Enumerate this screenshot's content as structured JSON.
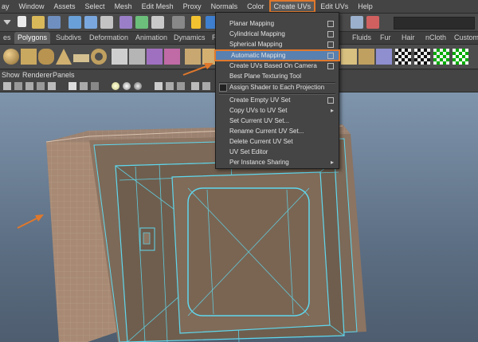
{
  "menubar": {
    "items": [
      "ay",
      "Window",
      "Assets",
      "Select",
      "Mesh",
      "Edit Mesh",
      "Proxy",
      "Normals",
      "Color",
      "Create UVs",
      "Edit UVs",
      "Help"
    ],
    "active_index": 9
  },
  "shelf_tabs": [
    "es",
    "Polygons",
    "Subdivs",
    "Deformation",
    "Animation",
    "Dynamics",
    "R",
    "Fluids",
    "Fur",
    "Hair",
    "nCloth",
    "Custom"
  ],
  "shelf_tabs_active_index": 1,
  "panel_menu": [
    "Show",
    "Renderer",
    "Panels"
  ],
  "create_uvs_menu": {
    "items": [
      {
        "label": "Planar Mapping",
        "type": "option"
      },
      {
        "label": "Cylindrical Mapping",
        "type": "option"
      },
      {
        "label": "Spherical Mapping",
        "type": "option"
      },
      {
        "label": "Automatic Mapping",
        "type": "option",
        "highlighted": true
      },
      {
        "label": "Create UVs Based On Camera",
        "type": "option"
      },
      {
        "label": "Best Plane Texturing Tool",
        "type": "plain"
      },
      {
        "label": "Assign Shader to Each Projection",
        "type": "checkbox"
      },
      {
        "label": "Create Empty UV Set",
        "type": "option"
      },
      {
        "label": "Copy UVs to UV Set",
        "type": "submenu"
      },
      {
        "label": "Set Current UV Set...",
        "type": "plain"
      },
      {
        "label": "Rename Current UV Set...",
        "type": "plain"
      },
      {
        "label": "Delete Current UV Set",
        "type": "plain"
      },
      {
        "label": "UV Set Editor",
        "type": "plain"
      },
      {
        "label": "Per Instance Sharing",
        "type": "submenu"
      }
    ]
  },
  "colors": {
    "accent_orange": "#e0782c",
    "menu_highlight": "#5880b0",
    "wireframe": "#5fd8ee",
    "object_face": "#a88a74"
  }
}
